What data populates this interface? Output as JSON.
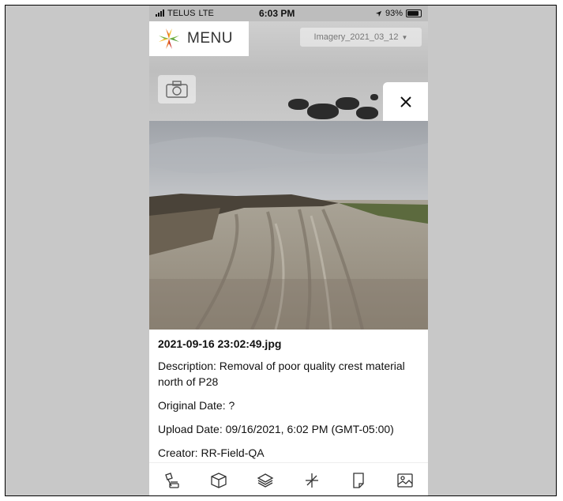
{
  "status_bar": {
    "carrier": "TELUS",
    "network": "LTE",
    "time": "6:03 PM",
    "battery": "93%"
  },
  "header": {
    "menu_label": "MENU",
    "imagery_selected": "Imagery_2021_03_12"
  },
  "icons": {
    "logo": "star-compass-logo",
    "camera": "camera-icon",
    "close": "close-icon",
    "toolbar": [
      "survey-tool-icon",
      "box-3d-icon",
      "layers-icon",
      "measure-icon",
      "note-icon",
      "image-icon"
    ]
  },
  "photo_panel": {
    "filename": "2021-09-16 23:02:49.jpg",
    "description": "Description: Removal of poor quality crest material north of P28",
    "original_date": "Original Date: ?",
    "upload_date": "Upload Date: 09/16/2021, 6:02 PM (GMT-05:00)",
    "creator": "Creator: RR-Field-QA"
  },
  "colors": {
    "logo_orange": "#e8731f",
    "logo_green": "#7ab648",
    "logo_red": "#c8342b",
    "logo_yellow": "#f2b824"
  }
}
